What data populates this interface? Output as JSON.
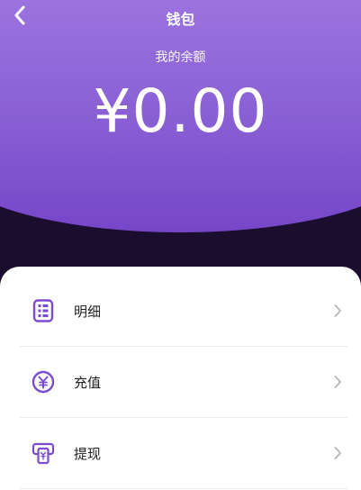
{
  "header": {
    "title": "钱包",
    "balance_label": "我的余额",
    "balance_amount": "¥0.00"
  },
  "menu": {
    "items": [
      {
        "label": "明细",
        "icon": "list-detail-icon"
      },
      {
        "label": "充值",
        "icon": "yuan-coin-icon"
      },
      {
        "label": "提现",
        "icon": "withdraw-card-icon"
      }
    ]
  },
  "colors": {
    "accent": "#7b4dcc",
    "header_gradient_top": "#9d74e0",
    "header_gradient_bottom": "#7646c8",
    "background_dark": "#1a0d2e"
  }
}
